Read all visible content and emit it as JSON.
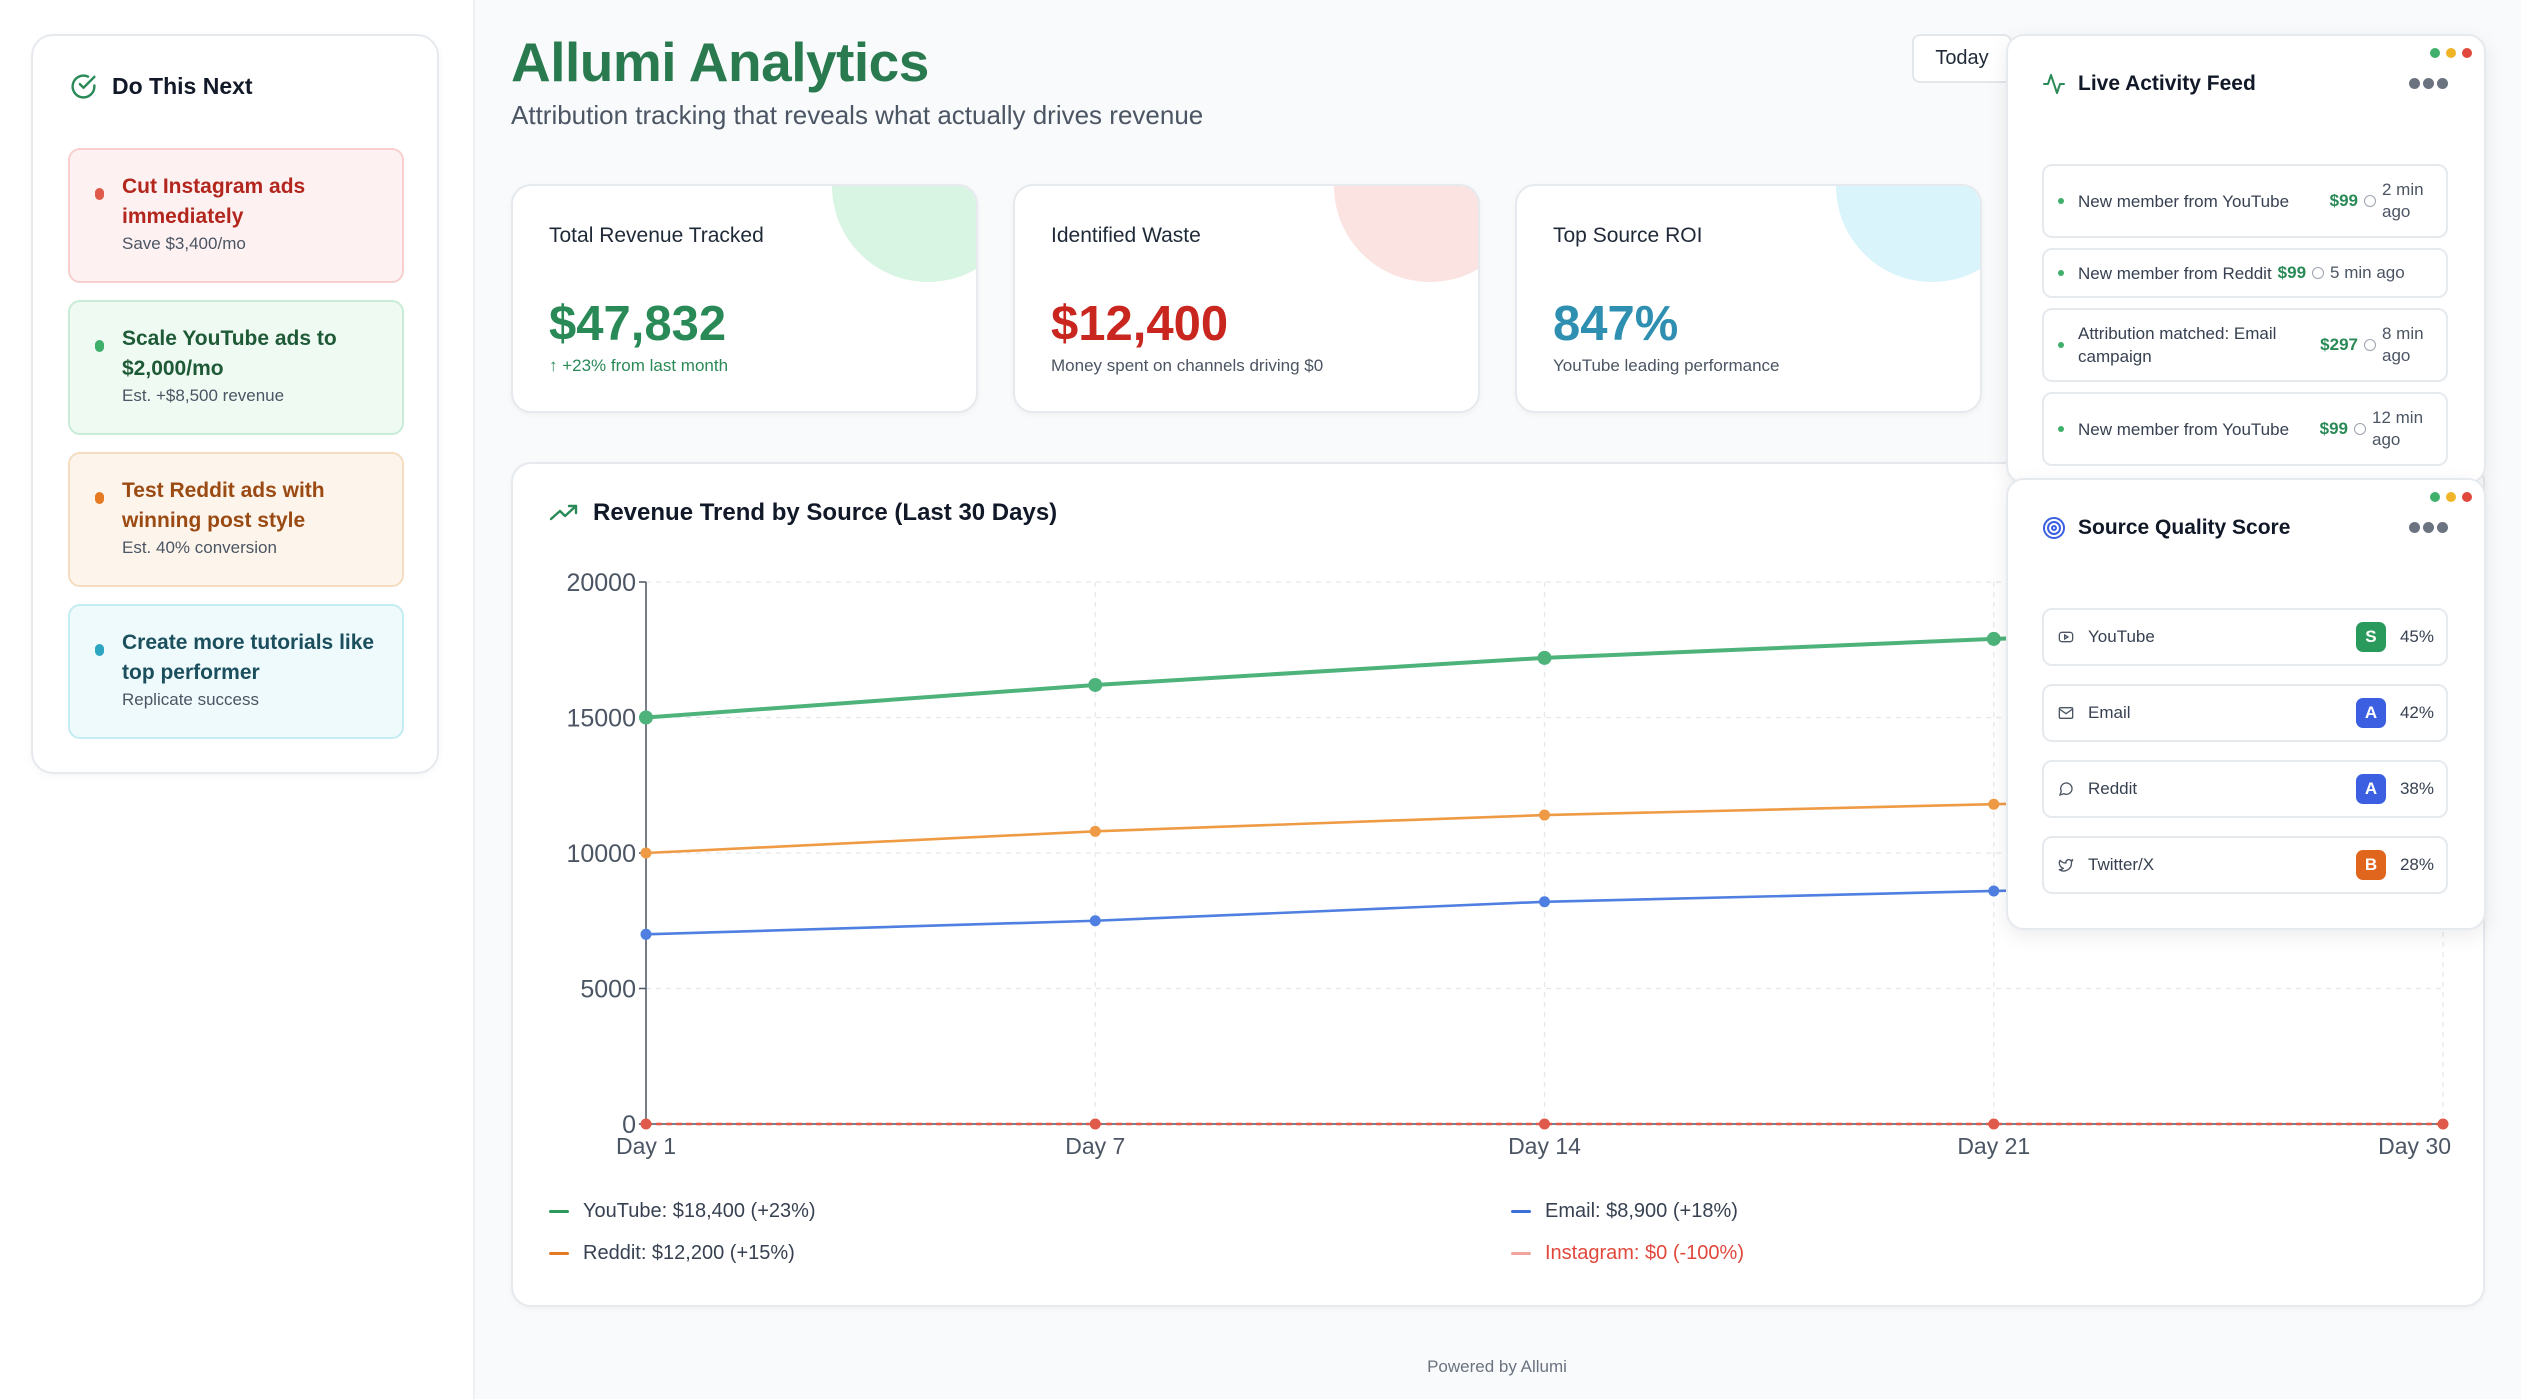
{
  "sidebar": {
    "title": "Do This Next",
    "actions": [
      {
        "title": "Cut Instagram ads immediately",
        "sub": "Save $3,400/mo"
      },
      {
        "title": "Scale YouTube ads to $2,000/mo",
        "sub": "Est. +$8,500 revenue"
      },
      {
        "title": "Test Reddit ads with winning post style",
        "sub": "Est. 40% conversion"
      },
      {
        "title": "Create more tutorials like top performer",
        "sub": "Replicate success"
      }
    ]
  },
  "header": {
    "title": "Allumi Analytics",
    "subtitle": "Attribution tracking that reveals what actually drives revenue",
    "date_button": "Today"
  },
  "stats": [
    {
      "label": "Total Revenue Tracked",
      "value": "$47,832",
      "sub": "↑ +23% from last month"
    },
    {
      "label": "Identified Waste",
      "value": "$12,400",
      "sub": "Money spent on channels driving $0"
    },
    {
      "label": "Top Source ROI",
      "value": "847%",
      "sub": "YouTube leading performance"
    }
  ],
  "chart_data": {
    "type": "line",
    "title": "Revenue Trend by Source (Last 30 Days)",
    "categories": [
      "Day 1",
      "Day 7",
      "Day 14",
      "Day 21",
      "Day 30"
    ],
    "ylim": [
      0,
      20000
    ],
    "yticks": [
      "0",
      "5000",
      "10000",
      "15000",
      "20000"
    ],
    "grid": true,
    "series": [
      {
        "name": "YouTube",
        "color": "#4db37a",
        "values": [
          15000,
          16200,
          17200,
          17900,
          18400
        ]
      },
      {
        "name": "Reddit",
        "color": "#ef9a45",
        "values": [
          10000,
          10800,
          11400,
          11800,
          12200
        ]
      },
      {
        "name": "Email",
        "color": "#4f7fe0",
        "values": [
          7000,
          7500,
          8200,
          8600,
          8900
        ]
      },
      {
        "name": "Instagram",
        "color": "#e05a4c",
        "values": [
          0,
          0,
          0,
          0,
          0
        ]
      }
    ],
    "legend": [
      {
        "label": "YouTube: $18,400 (+23%)",
        "color": "#2a9a5c",
        "text_color": "#374151"
      },
      {
        "label": "Email: $8,900 (+18%)",
        "color": "#3b6fd8",
        "text_color": "#374151"
      },
      {
        "label": "Reddit: $12,200 (+15%)",
        "color": "#e57a22",
        "text_color": "#374151"
      },
      {
        "label": "Instagram: $0 (-100%)",
        "color": "#f2a49c",
        "text_color": "#e0483c"
      }
    ]
  },
  "feed": {
    "title": "Live Activity Feed",
    "items": [
      {
        "text": "New member from YouTube",
        "amount": "$99",
        "time": "2 min ago"
      },
      {
        "text": "New member from Reddit",
        "amount": "$99",
        "time": "5 min ago"
      },
      {
        "text": "Attribution matched: Email campaign",
        "amount": "$297",
        "time": "8 min ago"
      },
      {
        "text": "New member from YouTube",
        "amount": "$99",
        "time": "12 min ago"
      }
    ]
  },
  "quality": {
    "title": "Source Quality Score",
    "items": [
      {
        "name": "YouTube",
        "icon": "youtube-icon",
        "grade": "S",
        "grade_color": "#2a9a5c",
        "pct": "45%"
      },
      {
        "name": "Email",
        "icon": "mail-icon",
        "grade": "A",
        "grade_color": "#3b5fe0",
        "pct": "42%"
      },
      {
        "name": "Reddit",
        "icon": "chat-bubble-icon",
        "grade": "A",
        "grade_color": "#3b5fe0",
        "pct": "38%"
      },
      {
        "name": "Twitter/X",
        "icon": "twitter-bird-icon",
        "grade": "B",
        "grade_color": "#e0661e",
        "pct": "28%"
      }
    ]
  },
  "window_dots": [
    "#3fb06b",
    "#f0b429",
    "#e0483c"
  ],
  "footer": "Powered by Allumi"
}
